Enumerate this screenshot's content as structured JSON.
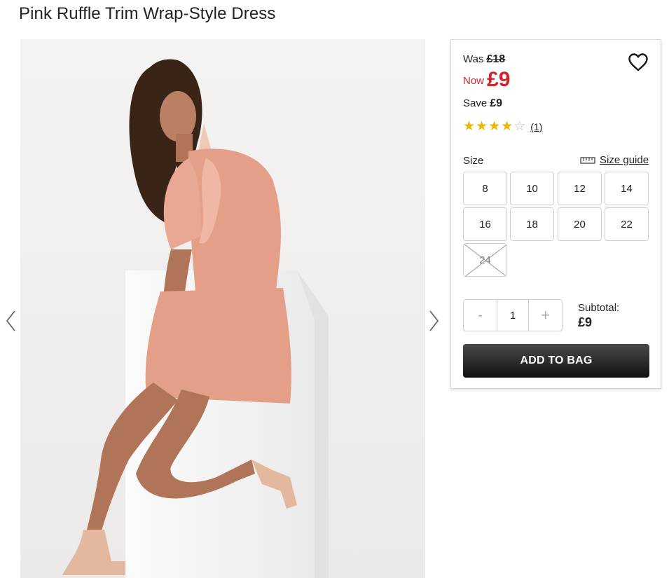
{
  "product": {
    "title": "Pink Ruffle Trim Wrap-Style Dress"
  },
  "gallery": {
    "image_name": "model-wearing-pink-dress-photo",
    "prev_icon": "chevron-left-icon",
    "next_icon": "chevron-right-icon"
  },
  "pricing": {
    "was_label": "Was",
    "was_price": "£18",
    "now_label": "Now",
    "now_price": "£9",
    "save_label": "Save",
    "save_amount": "£9",
    "accent_color": "#d3242a"
  },
  "wishlist": {
    "icon": "heart-icon"
  },
  "rating": {
    "stars": 4,
    "out_of": 5,
    "review_count": "(1)",
    "star_color": "#f0b400"
  },
  "size": {
    "label": "Size",
    "guide_label": "Size guide",
    "guide_icon": "ruler-icon",
    "options": [
      {
        "label": "8",
        "available": true
      },
      {
        "label": "10",
        "available": true
      },
      {
        "label": "12",
        "available": true
      },
      {
        "label": "14",
        "available": true
      },
      {
        "label": "16",
        "available": true
      },
      {
        "label": "18",
        "available": true
      },
      {
        "label": "20",
        "available": true
      },
      {
        "label": "22",
        "available": true
      },
      {
        "label": "24",
        "available": false
      }
    ]
  },
  "quantity": {
    "minus_label": "-",
    "value": "1",
    "plus_label": "+"
  },
  "subtotal": {
    "label": "Subtotal:",
    "value": "£9"
  },
  "add_to_bag": {
    "label": "ADD TO BAG"
  }
}
